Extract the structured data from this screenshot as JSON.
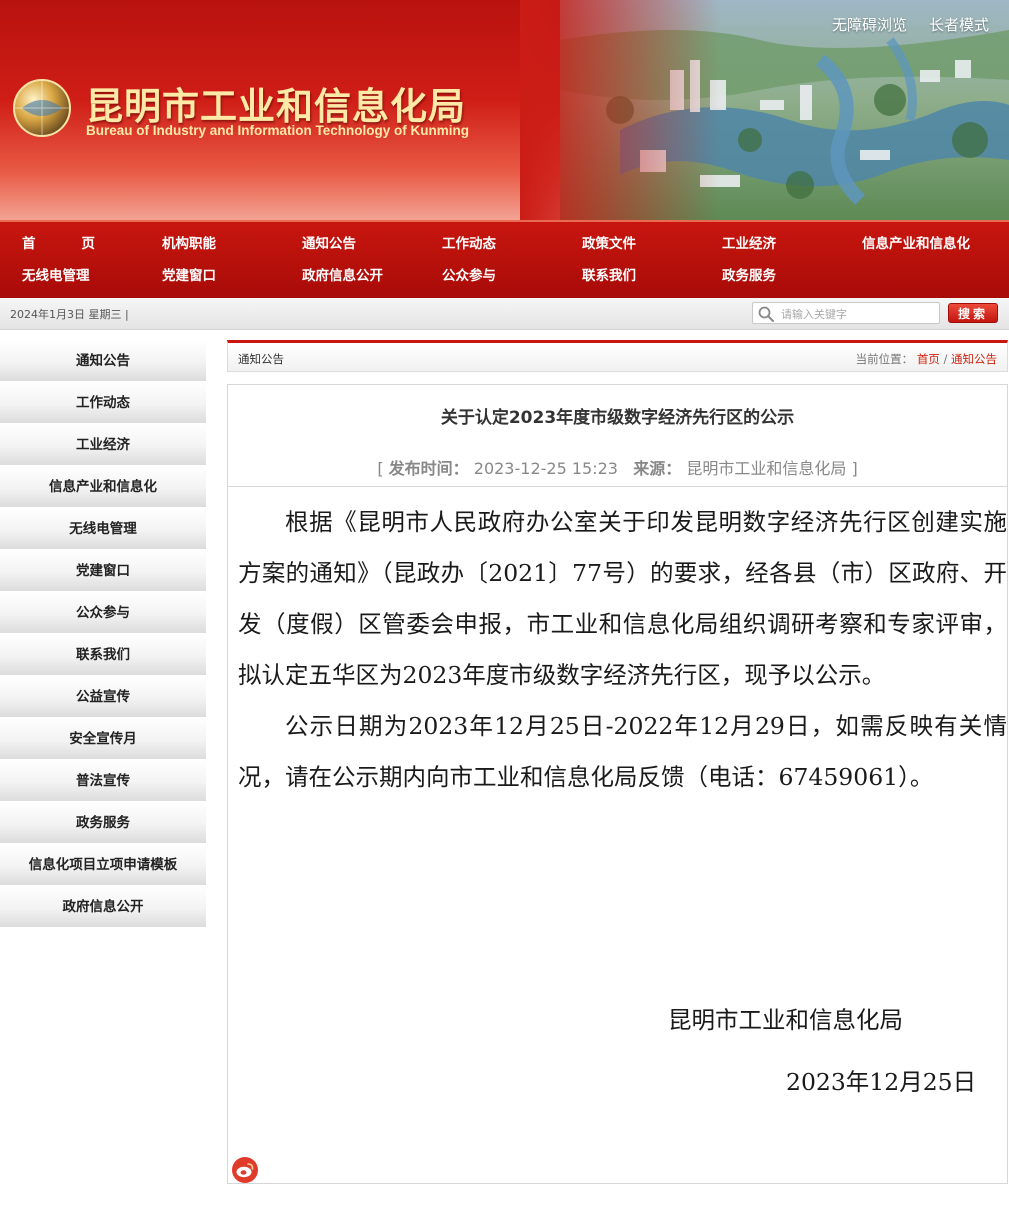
{
  "header": {
    "site_title": "昆明市工业和信息化局",
    "site_subtitle": "Bureau of Industry and Information Technology of Kunming",
    "top_links": [
      "无障碍浏览",
      "长者模式"
    ]
  },
  "nav": {
    "row1": [
      "首",
      "页",
      "机构职能",
      "通知公告",
      "工作动态",
      "政策文件",
      "工业经济",
      "信息产业和信息化"
    ],
    "row2": [
      "无线电管理",
      "党建窗口",
      "政府信息公开",
      "公众参与",
      "联系我们",
      "政务服务"
    ]
  },
  "infobar": {
    "date": "2024年1月3日 星期三 |",
    "search_placeholder": "请输入关键字",
    "search_button": "搜索"
  },
  "sidebar": {
    "items": [
      "通知公告",
      "工作动态",
      "工业经济",
      "信息产业和信息化",
      "无线电管理",
      "党建窗口",
      "公众参与",
      "联系我们",
      "公益宣传",
      "安全宣传月",
      "普法宣传",
      "政务服务",
      "信息化项目立项申请模板",
      "政府信息公开"
    ]
  },
  "breadcrumb": {
    "section_title": "通知公告",
    "location_label": "当前位置：",
    "home": "首页",
    "separator": "/",
    "current": "通知公告"
  },
  "article": {
    "title": "关于认定2023年度市级数字经济先行区的公示",
    "meta_open": "[",
    "publish_label": "发布时间：",
    "publish_time": "2023-12-25 15:23",
    "source_label": "来源：",
    "source": "昆明市工业和信息化局",
    "meta_close": "]",
    "paragraphs": [
      "根据《昆明市人民政府办公室关于印发昆明数字经济先行区创建实施方案的通知》（昆政办〔2021〕77号）的要求，经各县（市）区政府、开发（度假）区管委会申报，市工业和信息化局组织调研考察和专家评审，拟认定五华区为2023年度市级数字经济先行区，现予以公示。",
      "公示日期为2023年12月25日-2022年12月29日，如需反映有关情况，请在公示期内向市工业和信息化局反馈（电话：67459061）。"
    ],
    "sign_org": "昆明市工业和信息化局",
    "sign_date": "2023年12月25日"
  },
  "icons": {
    "logo": "globe-logo-icon",
    "search": "search-icon",
    "weibo": "weibo-icon"
  },
  "colors": {
    "brand_red": "#c8160f",
    "title_gold": "#ffe9a6",
    "link_red": "#d2230f"
  }
}
